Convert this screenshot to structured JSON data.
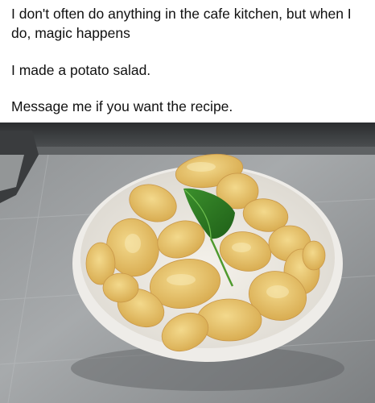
{
  "post": {
    "paragraphs": [
      "I don't often do anything in the cafe kitchen, but when I do, magic happens",
      "I made a potato salad.",
      "Message me if you want the recipe."
    ]
  },
  "photo": {
    "subject": "white bowl of potato chips with a basil leaf on a steel counter"
  }
}
